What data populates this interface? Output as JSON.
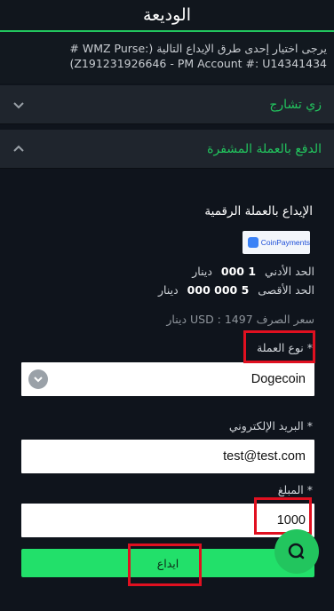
{
  "header": {
    "title": "الوديعة"
  },
  "instructions": {
    "line1": "يرجى اختيار إحدى طرق الإيداع التالية (:WMZ Purse #",
    "line2": "(Z191231926646 - PM Account #: U14341434"
  },
  "accordions": [
    {
      "label": "زي تشارج",
      "state": "collapsed"
    },
    {
      "label": "الدفع بالعملة المشفرة",
      "state": "expanded"
    }
  ],
  "crypto_panel": {
    "section_title": "الإيداع بالعملة الرقمية",
    "provider_logo_text": "CoinPayments",
    "min_label": "الحد الأدني",
    "min_value": "1 000",
    "min_unit": "دينار",
    "max_label": "الحد الأقصى",
    "max_value": "5 000 000",
    "max_unit": "دينار",
    "exchange_rate": "سعر الصرف USD : 1497 دينار",
    "currency_label": "* نوع العملة",
    "currency_value": "Dogecoin",
    "email_label": "* البريد الإلكتروني",
    "email_value": "test@test.com",
    "amount_label": "* المبلغ",
    "amount_value": "1000",
    "submit_label": "ايداع"
  },
  "colors": {
    "accent": "#22c55e",
    "submit_bg": "#22e06a",
    "background": "#0f141c",
    "accordion_bg": "#1f252d",
    "highlight_box": "#e01020"
  },
  "icons": {
    "accordion_collapsed": "chevron-down-icon",
    "accordion_expanded": "chevron-up-icon",
    "select": "chevron-down-icon",
    "chat": "chat-bubble-icon"
  }
}
